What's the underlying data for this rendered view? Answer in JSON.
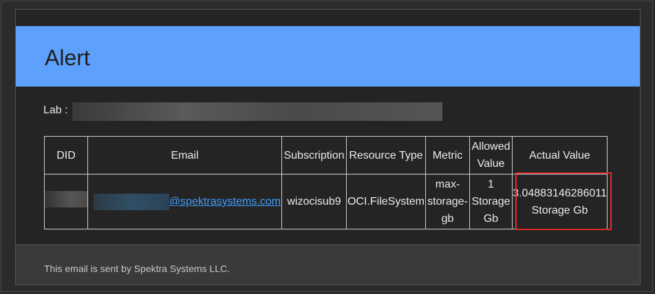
{
  "alert": {
    "title": "Alert",
    "lab_label": "Lab :",
    "table": {
      "headers": [
        "DID",
        "Email",
        "Subscription",
        "Resource Type",
        "Metric",
        "Allowed Value",
        "Actual Value"
      ],
      "row": {
        "email_domain": "@spektrasystems.com",
        "subscription": "wizocisub9",
        "resource_type": "OCI.FileSystem",
        "metric": "max-storage-gb",
        "allowed_value": "1 Storage Gb",
        "actual_value": "3.04883146286011 Storage Gb"
      }
    },
    "footer": "This email is sent by Spektra Systems LLC."
  },
  "colors": {
    "banner": "#5ea1fc",
    "highlight": "#e02b2b",
    "link": "#3ea0ff"
  }
}
